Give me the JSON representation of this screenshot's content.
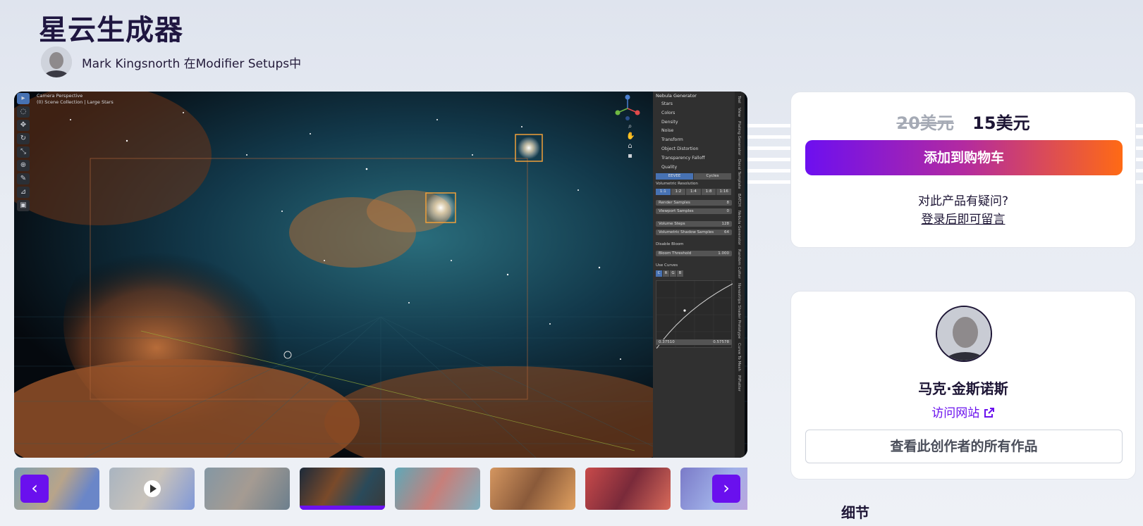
{
  "product": {
    "title": "星云生成器",
    "author_line": "Mark Kingsnorth 在Modifier Setups中"
  },
  "viewport": {
    "info_line1": "Camera Perspective",
    "info_line2": "(0) Scene Collection | Large Stars",
    "panel": {
      "header": "Nebula Generator",
      "sections": [
        "Stars",
        "Colors",
        "Density",
        "Noise",
        "Transform",
        "Object Distortion",
        "Transparency Falloff",
        "Quality"
      ],
      "engines": [
        "EEVEE",
        "Cycles"
      ],
      "vol_res_label": "Volumetric Resolution",
      "vol_res": [
        "1:1",
        "1:2",
        "1:4",
        "1:8",
        "1:16"
      ],
      "render_samples": {
        "label": "Render Samples",
        "value": "8"
      },
      "viewport_samples": {
        "label": "Viewport Samples",
        "value": "0"
      },
      "volume_steps": {
        "label": "Volume Steps",
        "value": "128"
      },
      "vol_shadow": {
        "label": "Volumetric Shadow Samples",
        "value": "64"
      },
      "disable_bloom": "Disable Bloom",
      "bloom_threshold": {
        "label": "Bloom Threshold",
        "value": "1.000"
      },
      "use_curves": "Use Curves",
      "curve_channels": [
        "C",
        "R",
        "G",
        "B"
      ],
      "curve_x": "0.37510",
      "curve_y": "0.57578",
      "tabs": [
        "Tool",
        "View",
        "Plating Generator",
        "Decal Template",
        "BATCH",
        "Nebula Generator",
        "Random Cutter",
        "Nanostrips Shader Prototype",
        "Curve To Mesh",
        "PiPlatter"
      ]
    }
  },
  "thumbnails": {
    "prev": "‹",
    "next": "›"
  },
  "purchase": {
    "old_price": "20美元",
    "new_price": "15美元",
    "cart_button": "添加到购物车",
    "question": "对此产品有疑问?",
    "login_link": "登录后即可留言"
  },
  "creator": {
    "name": "马克·金斯诺斯",
    "visit": "访问网站",
    "all_works": "查看此创作者的所有作品"
  },
  "details_heading": "细节",
  "colors": {
    "accent": "#6a10ee",
    "gradient_end": "#ff6a14",
    "title": "#1f1640"
  },
  "icons": [
    "play-icon",
    "external-link-icon",
    "chevron-left-icon",
    "chevron-right-icon"
  ]
}
